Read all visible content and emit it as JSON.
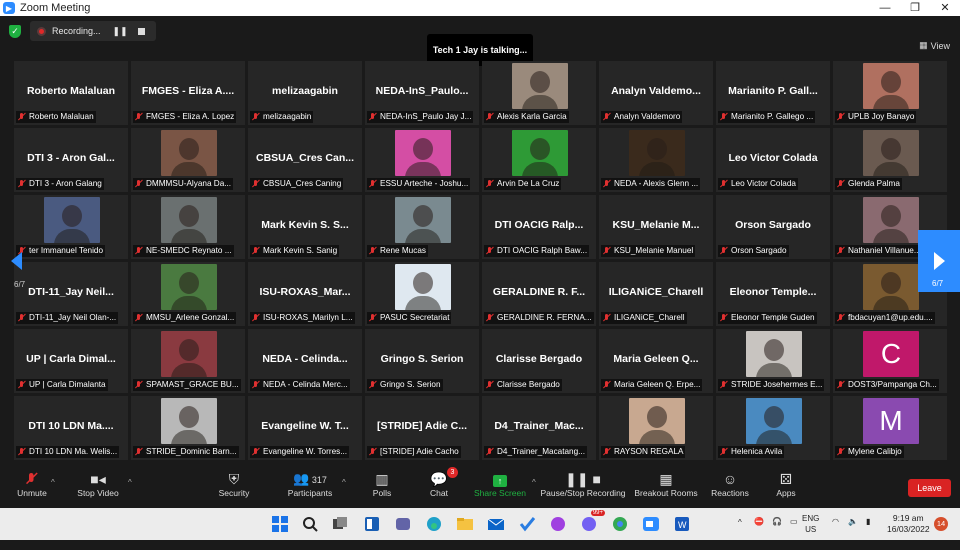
{
  "window": {
    "title": "Zoom Meeting",
    "controls": [
      "—",
      "❐",
      "✕"
    ]
  },
  "recording": {
    "label": "Recording..."
  },
  "speaker_banner": "Tech 1 Jay is talking...",
  "view_label": "View",
  "page_indicator": {
    "left": "6/7",
    "right": "6/7"
  },
  "tiles": [
    {
      "big": "Roberto Malaluan",
      "label": "Roberto Malaluan",
      "photo": null
    },
    {
      "big": "FMGES - Eliza A....",
      "label": "FMGES - Eliza A. Lopez",
      "photo": null
    },
    {
      "big": "melizaagabin",
      "label": "melizaagabin",
      "photo": null
    },
    {
      "big": "NEDA-InS_Paulo...",
      "label": "NEDA-InS_Paulo Jay J...",
      "photo": null
    },
    {
      "big": "",
      "label": "Alexis Karla Garcia",
      "photo": "#9a8a7c"
    },
    {
      "big": "Analyn  Valdemo...",
      "label": "Analyn Valdemoro",
      "photo": null
    },
    {
      "big": "Marianito  P. Gall...",
      "label": "Marianito P. Gallego ...",
      "photo": null
    },
    {
      "big": "",
      "label": "UPLB Joy Banayo",
      "photo": "#b07060"
    },
    {
      "big": "DTI 3 - Aron Gal...",
      "label": "DTI 3 - Aron Galang",
      "photo": null
    },
    {
      "big": "",
      "label": "DMMMSU-Alyana Da...",
      "photo": "#7a5545"
    },
    {
      "big": "CBSUA_Cres  Can...",
      "label": "CBSUA_Cres Caning",
      "photo": null
    },
    {
      "big": "",
      "label": "ESSU Arteche - Joshu...",
      "photo": "#d44ea4"
    },
    {
      "big": "",
      "label": "Arvin De La Cruz",
      "photo": "#2e9a36"
    },
    {
      "big": "",
      "label": "NEDA - Alexis Glenn ...",
      "photo": "#3a2a1c"
    },
    {
      "big": "Leo Victor Colada",
      "label": "Leo Victor Colada",
      "photo": null
    },
    {
      "big": "",
      "label": "Glenda Palma",
      "photo": "#6a5a50"
    },
    {
      "big": "",
      "label": "ter Immanuel Tenido",
      "photo": "#4a5a80"
    },
    {
      "big": "",
      "label": "NE-SMEDC Reynato ...",
      "photo": "#6a7070"
    },
    {
      "big": "Mark Kevin  S. S...",
      "label": "Mark Kevin S. Sanig",
      "photo": null
    },
    {
      "big": "",
      "label": "Rene Mucas",
      "photo": "#7a8a90"
    },
    {
      "big": "DTI OACIG Ralp...",
      "label": "DTI OACIG Ralph Baw...",
      "photo": null
    },
    {
      "big": "KSU_Melanie  M...",
      "label": "KSU_Melanie Manuel",
      "photo": null
    },
    {
      "big": "Orson Sargado",
      "label": "Orson Sargado",
      "photo": null
    },
    {
      "big": "",
      "label": "Nathaniel Villanue...",
      "photo": "#8a6a70"
    },
    {
      "big": "DTI-11_Jay  Neil...",
      "label": "DTI-11_Jay Neil Olan-...",
      "photo": null
    },
    {
      "big": "",
      "label": "MMSU_Arlene Gonzal...",
      "photo": "#4a7a40"
    },
    {
      "big": "ISU-ROXAS_Mar...",
      "label": "ISU-ROXAS_Marilyn L...",
      "photo": null
    },
    {
      "big": "",
      "label": "PASUC Secretariat",
      "photo": "#dfe8f0"
    },
    {
      "big": "GERALDINE  R. F...",
      "label": "GERALDINE R. FERNA...",
      "photo": null
    },
    {
      "big": "ILIGANiCE_Charell",
      "label": "ILIGANiCE_Charell",
      "photo": null
    },
    {
      "big": "Eleonor  Temple...",
      "label": "Eleonor Temple Guden",
      "photo": null
    },
    {
      "big": "",
      "label": "fbdacuyan1@up.edu....",
      "photo": "#7a5a30"
    },
    {
      "big": "UP | Carla  Dimal...",
      "label": "UP | Carla Dimalanta",
      "photo": null
    },
    {
      "big": "",
      "label": "SPAMAST_GRACE BU...",
      "photo": "#8a3a40"
    },
    {
      "big": "NEDA - Celinda...",
      "label": "NEDA - Celinda Merc...",
      "photo": null
    },
    {
      "big": "Gringo S. Serion",
      "label": "Gringo S. Serion",
      "photo": null
    },
    {
      "big": "Clarisse Bergado",
      "label": "Clarisse Bergado",
      "photo": null
    },
    {
      "big": "Maria  Geleen  Q...",
      "label": "Maria Geleen Q. Erpe...",
      "photo": null
    },
    {
      "big": "",
      "label": "STRIDE Josehermes E...",
      "photo": "#c8c4c0"
    },
    {
      "big": "",
      "label": "DOST3/Pampanga Ch...",
      "photo": "#c0186a",
      "letter": "C"
    },
    {
      "big": "DTI 10 LDN  Ma....",
      "label": "DTI 10 LDN Ma. Welis...",
      "photo": null
    },
    {
      "big": "",
      "label": "STRIDE_Dominic Barn...",
      "photo": "#b8b8b8"
    },
    {
      "big": "Evangeline  W. T...",
      "label": "Evangeline W. Torres...",
      "photo": null
    },
    {
      "big": "[STRIDE] Adie C...",
      "label": "[STRIDE] Adie Cacho",
      "photo": null
    },
    {
      "big": "D4_Trainer_Mac...",
      "label": "D4_Trainer_Macatang...",
      "photo": null
    },
    {
      "big": "",
      "label": "RAYSON REGALA",
      "photo": "#c8a890"
    },
    {
      "big": "",
      "label": "Helenica Avila",
      "photo": "#4a8ac0"
    },
    {
      "big": "",
      "label": "Mylene Calibjo",
      "photo": "#8a4ab0",
      "letter": "M"
    }
  ],
  "toolbar": {
    "unmute": "Unmute",
    "stop_video": "Stop Video",
    "security": "Security",
    "participants": "Participants",
    "participants_count": "317",
    "polls": "Polls",
    "chat": "Chat",
    "chat_badge": "3",
    "share_screen": "Share Screen",
    "pause_stop": "Pause/Stop Recording",
    "breakout": "Breakout Rooms",
    "reactions": "Reactions",
    "apps": "Apps",
    "leave": "Leave"
  },
  "taskbar": {
    "lang_top": "ENG",
    "lang_bottom": "US",
    "time": "9:19 am",
    "date": "16/03/2022",
    "notifications": "14",
    "viber_badge": "99+"
  },
  "colors": {
    "accent": "#2d8cff",
    "leave": "#d92323",
    "share": "#1fb141",
    "mute": "#e03030"
  }
}
